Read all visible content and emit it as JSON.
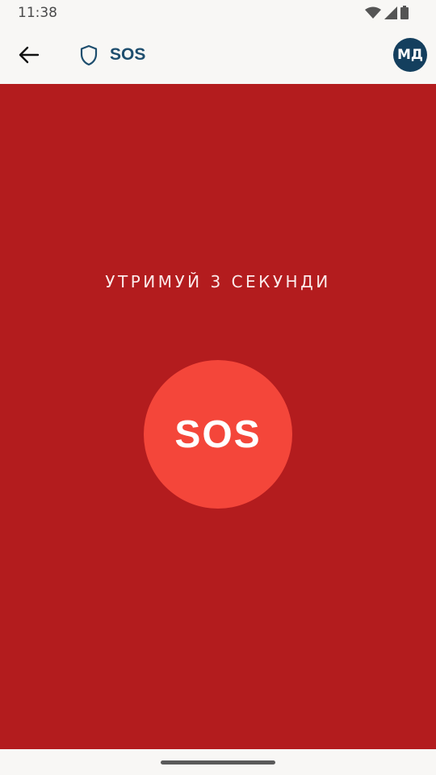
{
  "status_bar": {
    "time": "11:38",
    "icons": [
      "wifi-icon",
      "signal-icon",
      "battery-icon"
    ]
  },
  "app_bar": {
    "back_icon": "arrow-back-icon",
    "shield_icon": "shield-icon",
    "title": "SOS",
    "avatar_initials": "МД"
  },
  "main": {
    "hint": "УТРИМУЙ 3 СЕКУНДИ",
    "sos_button_label": "SOS"
  },
  "colors": {
    "background_red": "#b31c1e",
    "button_red": "#f4463a",
    "title_blue": "#1e4e6e",
    "avatar_blue": "#143f5e"
  }
}
